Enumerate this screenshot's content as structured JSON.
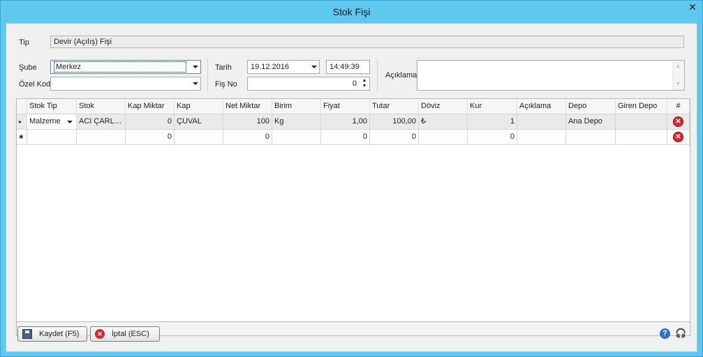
{
  "window": {
    "title": "Stok Fişi",
    "close_glyph": "✕"
  },
  "form": {
    "tip_label": "Tip",
    "tip_value": "Devir (Açılış) Fişi",
    "sube_label": "Şube",
    "sube_value": "Merkez",
    "ozelkod_label": "Özel Kod",
    "ozelkod_value": "",
    "tarih_label": "Tarih",
    "tarih_value": "19.12.2016",
    "saat_value": "14:49:39",
    "fisno_label": "Fiş No",
    "fisno_value": "0",
    "aciklama_label": "Açıklama",
    "aciklama_value": ""
  },
  "grid": {
    "headers": [
      "Stok Tip",
      "Stok",
      "Kap Miktar",
      "Kap",
      "Net Miktar",
      "Birim",
      "Fiyat",
      "Tutar",
      "Döviz",
      "Kur",
      "Açıklama",
      "Depo",
      "Giren Depo",
      "#"
    ],
    "rows": [
      {
        "indicator": "▸",
        "stok_tip": "Malzeme",
        "stok": "ACI ÇARL…",
        "kap_miktar": "0",
        "kap": "ÇUVAL",
        "net_miktar": "100",
        "birim": "Kg",
        "fiyat": "1,00",
        "tutar": "100,00",
        "doviz": "₺",
        "kur": "1",
        "aciklama": "",
        "depo": "Ana Depo",
        "giren_depo": ""
      },
      {
        "indicator": "✱",
        "stok_tip": "",
        "stok": "",
        "kap_miktar": "0",
        "kap": "",
        "net_miktar": "0",
        "birim": "",
        "fiyat": "0",
        "tutar": "0",
        "doviz": "",
        "kur": "0",
        "aciklama": "",
        "depo": "",
        "giren_depo": ""
      }
    ]
  },
  "buttons": {
    "save_label": "Kaydet (F5)",
    "cancel_label": "İptal (ESC)"
  },
  "icons": {
    "delete_glyph": "✕",
    "help_glyph": "?",
    "support_glyph": "🎧"
  },
  "colors": {
    "titlebar": "#5ec8ef",
    "delete": "#d9262c",
    "help": "#2c6fd6"
  }
}
